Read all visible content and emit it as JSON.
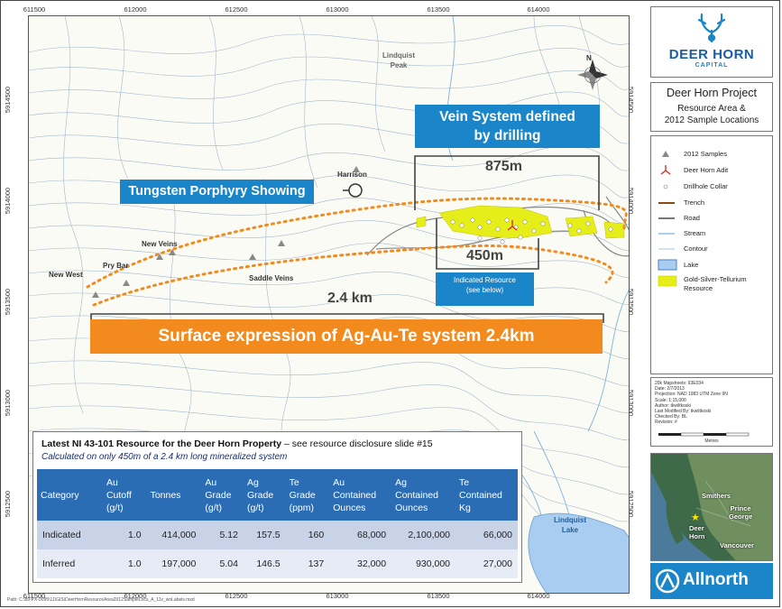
{
  "map": {
    "x_ticks_top": [
      "611500",
      "612000",
      "612500",
      "613000",
      "613500",
      "614000"
    ],
    "x_ticks_bottom": [
      "611500",
      "612000",
      "612500",
      "613000",
      "613500",
      "614000"
    ],
    "y_ticks_left": [
      "5914500",
      "5914000",
      "5913500",
      "5913000",
      "5912500"
    ],
    "y_ticks_right": [
      "5914500",
      "5914000",
      "5913500",
      "5913000",
      "5912500"
    ],
    "path_note": "Path: C:\\89-PX-0095\\11\\GIS\\DeerHornResourceArea2012SampleLocs_A_11x_wnLabels.mxd",
    "places": {
      "lindquist_peak": "Lindquist\nPeak",
      "harrison": "Harrison",
      "new_veins": "New Veins",
      "pry_bar": "Pry Bar",
      "new_west": "New West",
      "saddle_veins": "Saddle Veins",
      "lindquist_lake": "Lindquist\nLake"
    },
    "callouts": {
      "vein_system": "Vein System defined\nby drilling",
      "tungsten": "Tungsten Porphyry Showing",
      "surface_expression": "Surface expression of Ag-Au-Te system 2.4km",
      "indicated_resource": "Indicated Resource\n(see below)"
    },
    "dimensions": {
      "d875": "875m",
      "d450": "450m",
      "d24km": "2.4 km"
    },
    "compass": "N"
  },
  "resource_table": {
    "title_bold": "Latest NI 43-101 Resource for the Deer Horn Property",
    "title_rest": " – see resource disclosure slide #15",
    "subtitle": "Calculated on only 450m of a 2.4 km long mineralized system",
    "headers": [
      "Category",
      "Au\nCutoff\n(g/t)",
      "Tonnes",
      "Au\nGrade\n(g/t)",
      "Ag\nGrade\n(g/t)",
      "Te\nGrade\n(ppm)",
      "Au\nContained\nOunces",
      "Ag\nContained\nOunces",
      "Te\nContained\nKg"
    ],
    "rows": [
      [
        "Indicated",
        "1.0",
        "414,000",
        "5.12",
        "157.5",
        "160",
        "68,000",
        "2,100,000",
        "66,000"
      ],
      [
        "Inferred",
        "1.0",
        "197,000",
        "5.04",
        "146.5",
        "137",
        "32,000",
        "930,000",
        "27,000"
      ]
    ]
  },
  "panel": {
    "logo_line1": "DEER HORN",
    "logo_line2": "CAPITAL",
    "project_title": "Deer Horn Project",
    "subtitle_line1": "Resource Area &",
    "subtitle_line2": "2012 Sample Locations",
    "legend": [
      {
        "label": "2012 Samples",
        "icon": "triangle-grey"
      },
      {
        "label": "Deer Horn Adit",
        "icon": "adit-red"
      },
      {
        "label": "Drillhole Collar",
        "icon": "collar-circle"
      },
      {
        "label": "Trench",
        "icon": "line-brown"
      },
      {
        "label": "Road",
        "icon": "line-grey"
      },
      {
        "label": "Stream",
        "icon": "line-blue"
      },
      {
        "label": "Contour",
        "icon": "line-lightblue"
      },
      {
        "label": "Lake",
        "icon": "box-blue"
      },
      {
        "label": "Gold-Silver-Tellurium\nResource",
        "icon": "box-yellow"
      }
    ],
    "meta": [
      "20k Mapsheets: 93E034",
      "Date: 2/7/2013",
      "Projection: NAD 1983 UTM Zone 9N",
      "Scale: 1:15,000",
      "Author: tkwiltkoski",
      "Last Modified By: tkwiltkoski",
      "Checked By: BL",
      "Revision: #"
    ],
    "scale_label": "Metres",
    "inset_labels": {
      "smithers": "Smithers",
      "prince_george": "Prince\nGeorge",
      "deer_horn": "Deer\nHorn",
      "vancouver": "Vancouver"
    },
    "allnorth": "Allnorth"
  },
  "colors": {
    "callout_blue": "#1a85c8",
    "orange": "#f28a1e",
    "table_header": "#2b6db5",
    "resource_yellow": "#e6ee1a"
  }
}
